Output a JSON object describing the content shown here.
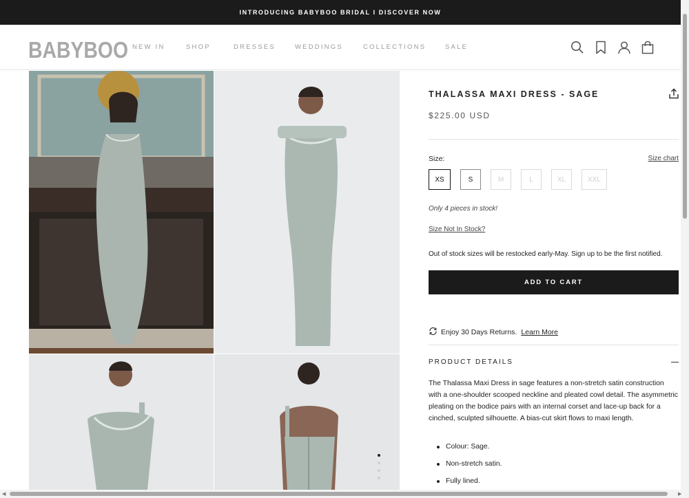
{
  "announcement": "INTRODUCING BABYBOO BRIDAL I DISCOVER NOW",
  "brand": {
    "logo": "BABYBOO"
  },
  "nav": [
    "NEW IN",
    "SHOP",
    "DRESSES",
    "WEDDINGS",
    "COLLECTIONS",
    "SALE"
  ],
  "header_icons": [
    "search-icon",
    "bookmark-icon",
    "account-icon",
    "bag-icon"
  ],
  "product": {
    "title": "THALASSA MAXI DRESS - SAGE",
    "price": "$225.00 USD",
    "size_label": "Size:",
    "size_chart": "Size chart",
    "sizes": [
      {
        "label": "XS",
        "state": "selected"
      },
      {
        "label": "S",
        "state": "available"
      },
      {
        "label": "M",
        "state": "unavailable"
      },
      {
        "label": "L",
        "state": "unavailable"
      },
      {
        "label": "XL",
        "state": "unavailable"
      },
      {
        "label": "XXL",
        "state": "unavailable"
      }
    ],
    "stock_note": "Only 4 pieces in stock!",
    "size_not_in_stock": "Size Not In Stock?",
    "restock_note": "Out of stock sizes will be restocked early-May. Sign up to be the first notified.",
    "add_to_cart": "ADD TO CART",
    "returns_text": "Enjoy 30 Days Returns.",
    "returns_link": "Learn More",
    "details_heading": "PRODUCT DETAILS",
    "description": "The Thalassa Maxi Dress in sage features a non-stretch satin construction with a one-shoulder scooped neckline and pleated cowl detail. The asymmetric pleating on the bodice pairs with an internal corset and lace-up back for a cinched, sculpted silhouette. A bias-cut skirt flows to maxi length.",
    "bullets": [
      "Colour: Sage.",
      "Non-stretch satin.",
      "Fully lined."
    ]
  },
  "gallery": {
    "images": 4,
    "active_dot": 1,
    "dots": 4
  },
  "colors": {
    "bar": "#1b1b1b",
    "dress": "#a9b8b2",
    "logo": "#a9a9a9"
  }
}
